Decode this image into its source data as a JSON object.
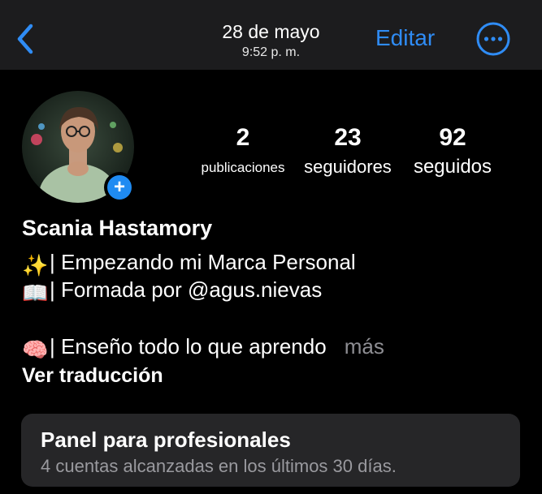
{
  "nav": {
    "date": "28 de mayo",
    "time": "9:52 p. m.",
    "edit_label": "Editar"
  },
  "colors": {
    "accent": "#2f8cf5",
    "background": "#000000",
    "panel": "#262628",
    "muted_text": "#8e8e93"
  },
  "profile": {
    "stats": {
      "posts": {
        "value": "2",
        "label": "publicaciones"
      },
      "followers": {
        "value": "23",
        "label": "seguidores"
      },
      "following": {
        "value": "92",
        "label": "seguidos"
      }
    },
    "add_badge": "+",
    "name": "Scania Hastamory",
    "bio": [
      {
        "icon": "sparkles-icon",
        "glyph": "✨",
        "text": "| Empezando mi Marca Personal"
      },
      {
        "icon": "open-book-icon",
        "glyph": "📖",
        "text": "| Formada por @agus.nievas"
      },
      {
        "icon": "brain-icon",
        "glyph": "🧠",
        "text": "| Enseño todo lo que aprendo"
      }
    ],
    "more_label": "más",
    "translate_label": "Ver traducción"
  },
  "pro_panel": {
    "title": "Panel para profesionales",
    "subtitle": "4 cuentas alcanzadas en los últimos 30 días."
  }
}
